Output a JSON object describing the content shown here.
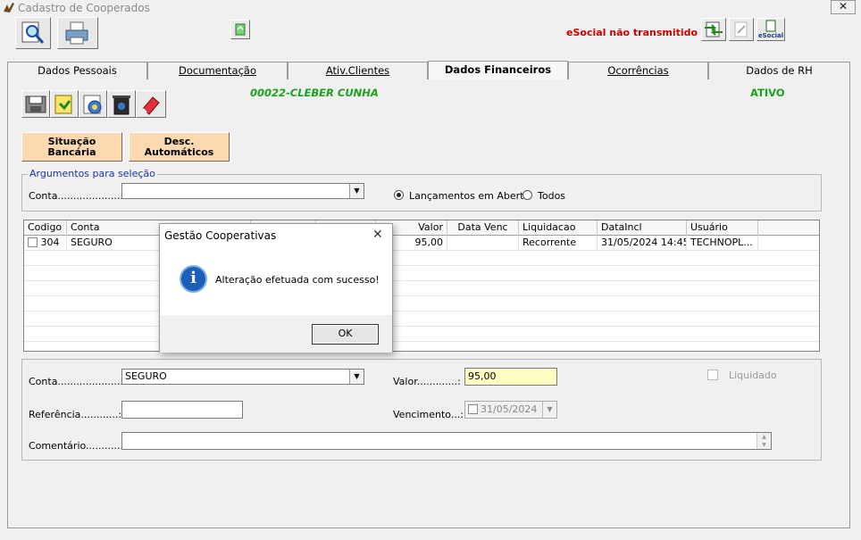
{
  "window": {
    "title": "Cadastro de Cooperados",
    "close_glyph": "✕"
  },
  "toolbar": {
    "esocial_status": "eSocial não transmitido",
    "esocial_label": "eSocial"
  },
  "tabs": [
    {
      "label": "Dados Pessoais",
      "active": false
    },
    {
      "label": "Documentação",
      "active": false
    },
    {
      "label": "Ativ.Clientes",
      "active": false
    },
    {
      "label": "Dados Financeiros",
      "active": true
    },
    {
      "label": "Ocorrências",
      "active": false
    },
    {
      "label": "Dados de RH",
      "active": false
    }
  ],
  "header": {
    "cooperado": "00022-CLEBER CUNHA",
    "status": "ATIVO"
  },
  "buttons": {
    "situacao_bancaria": "Situação Bancária",
    "desc_automaticos_1": "Desc.",
    "desc_automaticos_2": "Automáticos"
  },
  "args": {
    "legend": "Argumentos para seleção",
    "conta_label": "Conta.....................:",
    "conta_value": "",
    "radio_aberto": "Lançamentos em Aberto",
    "radio_todos": "Todos",
    "selected": "aberto"
  },
  "grid": {
    "headers": [
      "Codigo",
      "Conta",
      "Valor",
      "Data Venc",
      "Liquidacao",
      "DataIncl",
      "Usuário"
    ],
    "rows": [
      {
        "codigo": "304",
        "conta": "SEGURO",
        "valor": "95,00",
        "data_venc": "",
        "liquidacao": "Recorrente",
        "dataincl": "31/05/2024 14:45",
        "usuario": "TECHNOPL..."
      }
    ]
  },
  "form": {
    "conta_label": "Conta.....................:",
    "conta_value": "SEGURO",
    "valor_label": "Valor.............:",
    "valor_value": "95,00",
    "liquidado_label": "Liquidado",
    "referencia_label": "Referência............:",
    "referencia_value": "",
    "vencimento_label": "Vencimento...:",
    "vencimento_value": "31/05/2024",
    "comentario_label": "Comentário............:",
    "comentario_value": ""
  },
  "dialog": {
    "title": "Gestão Cooperativas",
    "close_glyph": "✕",
    "message": "Alteração efetuada com sucesso!",
    "ok_label": "OK",
    "icon_glyph": "i"
  },
  "colors": {
    "accent_green": "#1aa31a",
    "alert_red": "#cc0000",
    "info_blue": "#1b5fb8",
    "button_orange": "#fcd9b0"
  }
}
